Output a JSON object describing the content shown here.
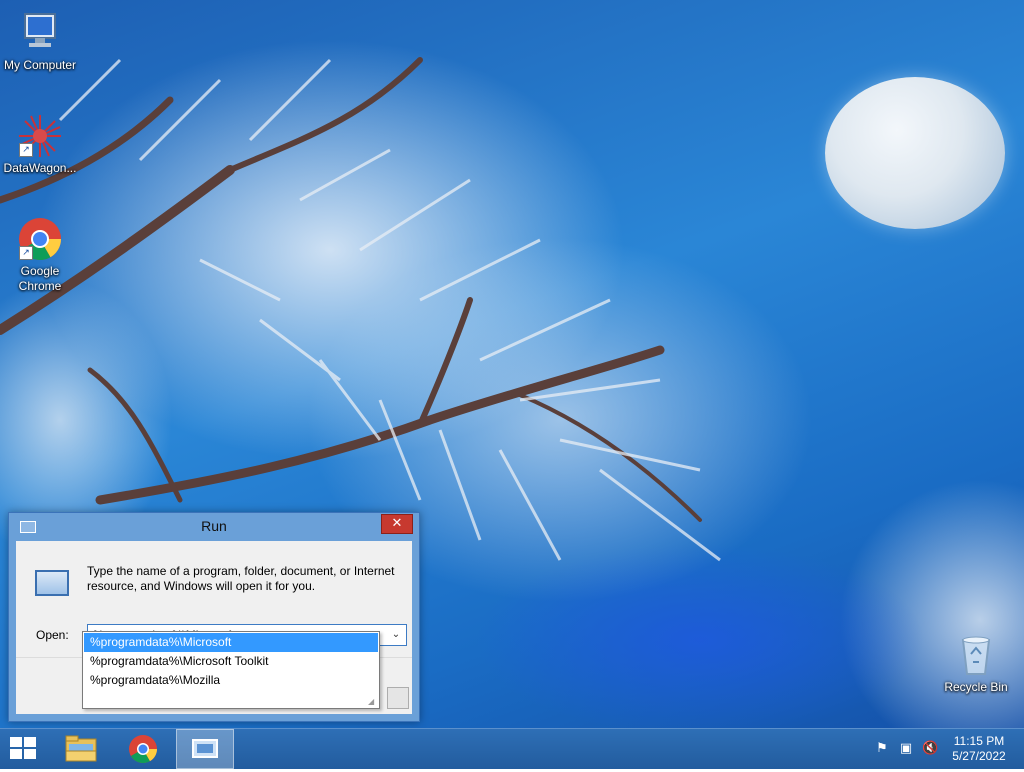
{
  "desktop": {
    "icons": [
      {
        "label": "My Computer",
        "icon": "computer-icon"
      },
      {
        "label": "DataWagon...",
        "icon": "datawagon-icon"
      },
      {
        "label": "Google Chrome",
        "icon": "chrome-icon"
      },
      {
        "label": "Recycle Bin",
        "icon": "recycle-bin-icon"
      }
    ]
  },
  "run_dialog": {
    "title": "Run",
    "close_symbol": "✕",
    "description": "Type the name of a program, folder, document, or Internet resource, and Windows will open it for you.",
    "open_label": "Open:",
    "open_value": "%programdata%\\Microsoft",
    "dropdown_arrow": "⌄",
    "suggestions": [
      {
        "label": "%programdata%\\Microsoft",
        "selected": true
      },
      {
        "label": "%programdata%\\Microsoft Toolkit",
        "selected": false
      },
      {
        "label": "%programdata%\\Mozilla",
        "selected": false
      }
    ]
  },
  "taskbar": {
    "items": [
      {
        "name": "start",
        "icon": "windows-logo-icon"
      },
      {
        "name": "file-explorer",
        "icon": "folder-icon"
      },
      {
        "name": "google-chrome",
        "icon": "chrome-icon"
      },
      {
        "name": "run",
        "icon": "run-icon",
        "active": true
      }
    ],
    "clock": {
      "time": "11:15 PM",
      "date": "5/27/2022"
    }
  },
  "colors": {
    "taskbar": "#2a68ad",
    "selection": "#3399ff",
    "close_button": "#c7392f",
    "dialog_frame": "#6aa0d8"
  }
}
